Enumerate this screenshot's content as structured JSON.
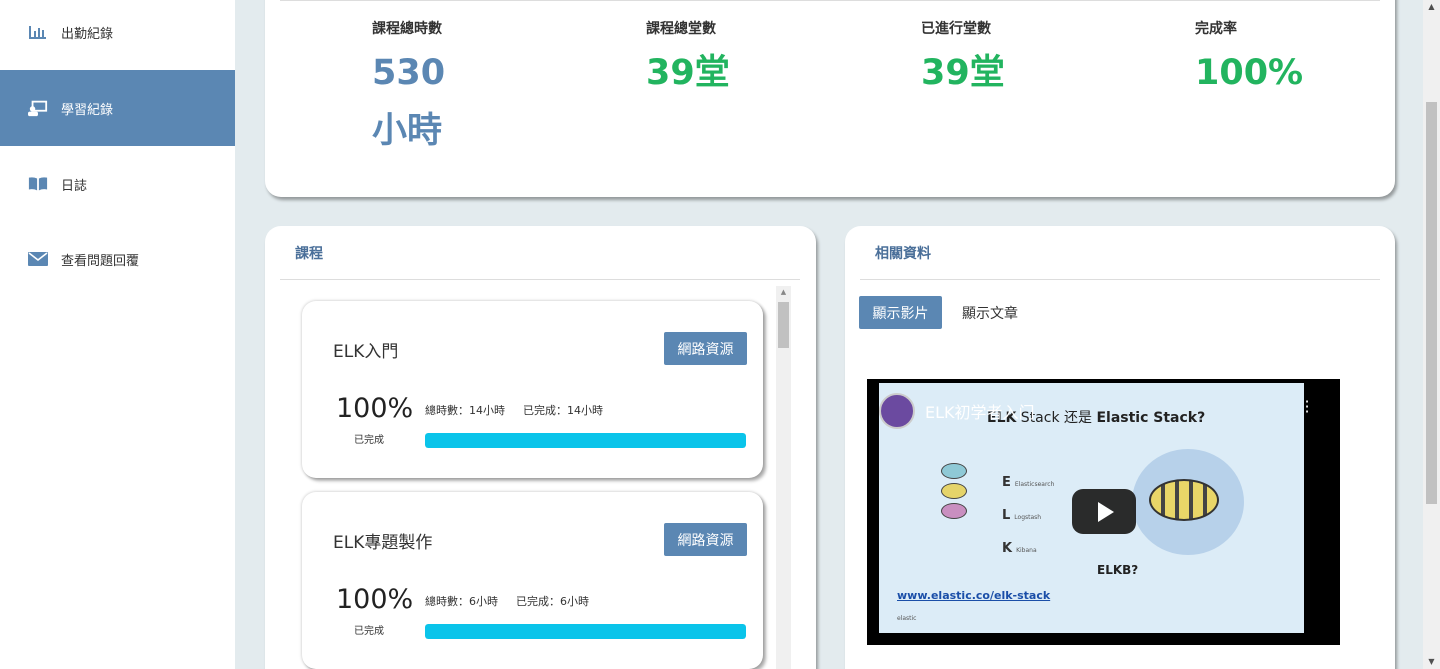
{
  "sidebar": {
    "items": [
      {
        "label": "出勤紀錄",
        "icon": "bar-chart-icon",
        "active": false
      },
      {
        "label": "學習紀錄",
        "icon": "presentation-icon",
        "active": true
      },
      {
        "label": "日誌",
        "icon": "book-icon",
        "active": false
      },
      {
        "label": "查看問題回覆",
        "icon": "envelope-icon",
        "active": false
      }
    ]
  },
  "stats": {
    "total_hours_label": "課程總時數",
    "total_hours_value": "530",
    "total_hours_unit": "小時",
    "total_sessions_label": "課程總堂數",
    "total_sessions_value": "39堂",
    "done_sessions_label": "已進行堂數",
    "done_sessions_value": "39堂",
    "completion_label": "完成率",
    "completion_value": "100%"
  },
  "courses": {
    "title": "課程",
    "items": [
      {
        "name": "ELK入門",
        "button": "網路資源",
        "percent": "100%",
        "done_label": "已完成",
        "total": "總時數：14小時",
        "completed": "已完成：14小時",
        "progress": 1.0
      },
      {
        "name": "ELK專題製作",
        "button": "網路資源",
        "percent": "100%",
        "done_label": "已完成",
        "total": "總時數：6小時",
        "completed": "已完成：6小時",
        "progress": 1.0
      }
    ]
  },
  "resources": {
    "title": "相關資料",
    "tab_video": "顯示影片",
    "tab_article": "顯示文章",
    "video": {
      "title": "ELK初学者入门",
      "slide_title_pre": "ELK",
      "slide_title_mid": " Stack 还是 ",
      "slide_title_post": "Elastic Stack?",
      "list": [
        "E",
        "L",
        "K"
      ],
      "list_sub": [
        "Elasticsearch",
        "Logstash",
        "Kibana"
      ],
      "caption": "ELKB?",
      "url": "www.elastic.co/elk-stack",
      "logo": "elastic"
    }
  },
  "colors": {
    "accent": "#5b87b3",
    "green": "#22b45f",
    "progress": "#0ac4ea",
    "background": "#e3ebee"
  }
}
